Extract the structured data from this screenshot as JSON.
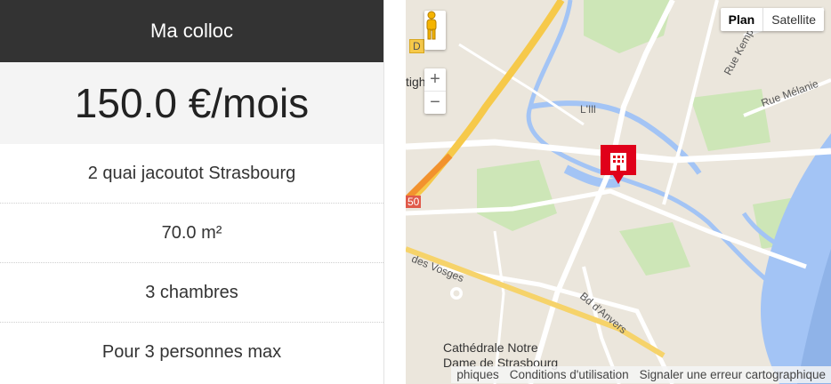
{
  "listing": {
    "title": "Ma colloc",
    "price": "150.0 €/mois",
    "details": [
      "2 quai jacoutot Strasbourg",
      "70.0 m²",
      "3 chambres",
      "Pour 3 personnes max"
    ]
  },
  "map": {
    "type_buttons": {
      "plan": "Plan",
      "satellite": "Satellite"
    },
    "zoom": {
      "in": "+",
      "out": "−"
    },
    "labels": {
      "place_1": "tigheim",
      "place_2": "L'Ill",
      "street_1": "Rue Kempf",
      "street_2": "Rue Mélanie",
      "street_3": "des Vosges",
      "street_4": "Bd d'Anvers",
      "poi_line_1": "Cathédrale Notre",
      "poi_line_2": "Dame de Strasbourg",
      "road_shield_1": "D",
      "road_shield_2": "50"
    },
    "footer": {
      "data_text": "phiques",
      "terms": "Conditions d'utilisation",
      "report": "Signaler une erreur cartographique"
    },
    "colors": {
      "water": "#a3c4f5",
      "park": "#cde6b7",
      "highway": "#f6c94a",
      "marker": "#e0001a"
    },
    "icons": {
      "pegman": "pegman-icon",
      "marker": "building-marker-icon"
    }
  }
}
